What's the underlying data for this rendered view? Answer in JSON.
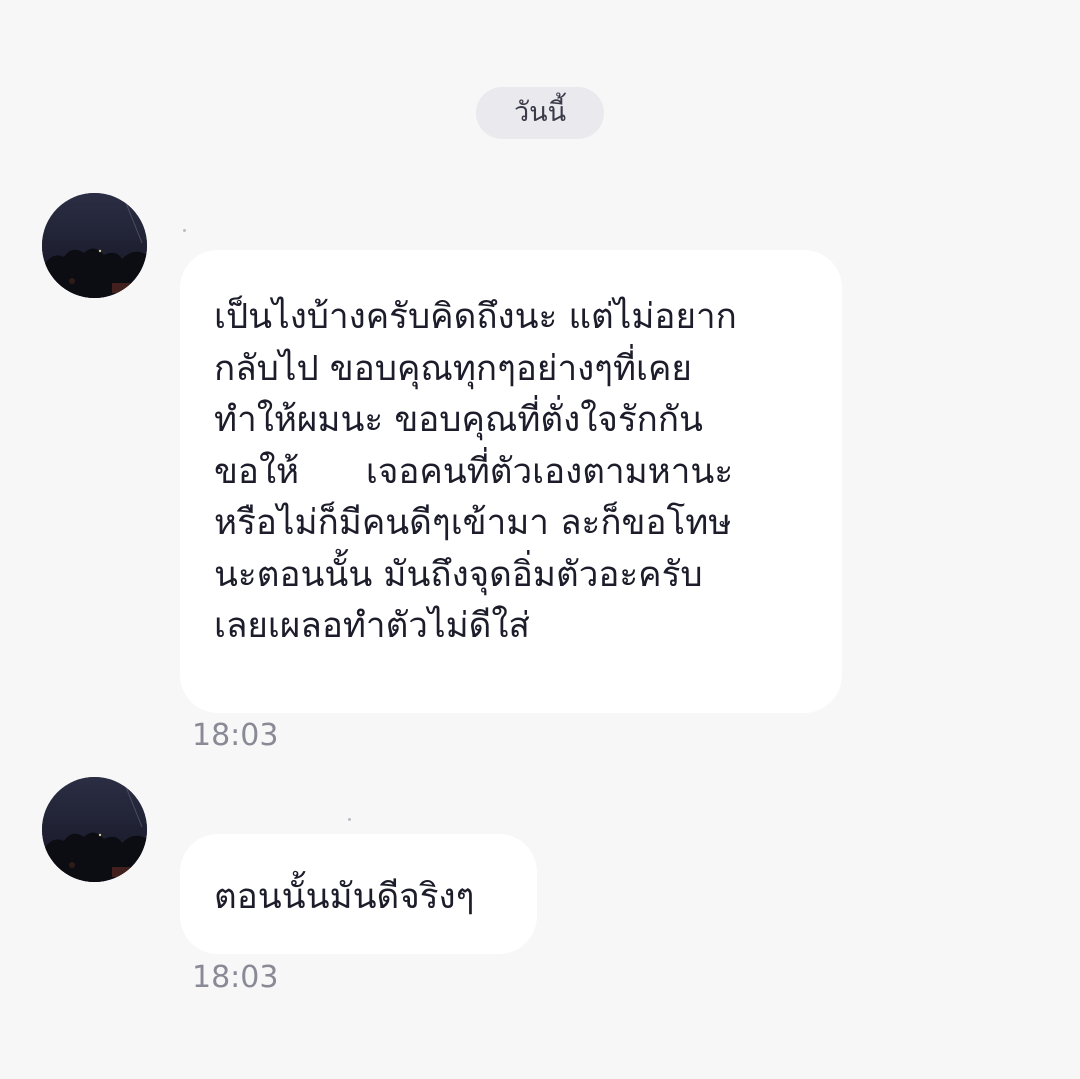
{
  "date_divider": "วันนี้",
  "messages": [
    {
      "text": "เป็นไงบ้างครับคิดถึงนะ แต่ไม่อยาก\nกลับไป ขอบคุณทุกๆอย่างๆที่เคย\nทำให้ผมนะ ขอบคุณที่ตั่งใจรักกัน\nขอให้      เจอคนที่ตัวเองตามหานะ\nหรือไม่ก็มีคนดีๆเข้ามา ละก็ขอโทษ\nนะตอนนั้น มันถึงจุดอิ่มตัวอะครับ\nเลยเผลอทำตัวไม่ดีใส่",
      "time": "18:03",
      "avatar_icon": "profile-photo-night-sky"
    },
    {
      "text": "ตอนนั้นมันดีจริงๆ",
      "time": "18:03",
      "avatar_icon": "profile-photo-night-sky"
    }
  ],
  "colors": {
    "background": "#f7f7f8",
    "bubble": "#ffffff",
    "text": "#1c1c2a",
    "timestamp": "#8a8a96",
    "date_chip": "#e9e9ee"
  }
}
